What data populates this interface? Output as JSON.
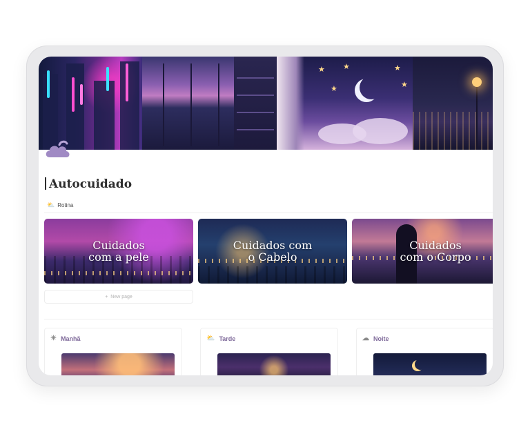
{
  "page": {
    "title": "Autocuidado",
    "section_tag": "Rotina",
    "section_tag_icon": "sun-behind-cloud-icon",
    "page_icon": "cloud-icon"
  },
  "gallery": {
    "cards": [
      {
        "label": "Cuidados\ncom a pele"
      },
      {
        "label": "Cuidados com\no Cabelo"
      },
      {
        "label": "Cuidados\ncom o Corpo"
      }
    ],
    "new_page_label": "New page"
  },
  "routine": {
    "columns": [
      {
        "label": "Manhã",
        "icon": "sun-icon"
      },
      {
        "label": "Tarde",
        "icon": "sun-behind-cloud-icon"
      },
      {
        "label": "Noite",
        "icon": "cloud-moon-icon"
      }
    ]
  },
  "colors": {
    "column_heading": "#7f6a9a",
    "page_icon": "#a08ac4"
  }
}
